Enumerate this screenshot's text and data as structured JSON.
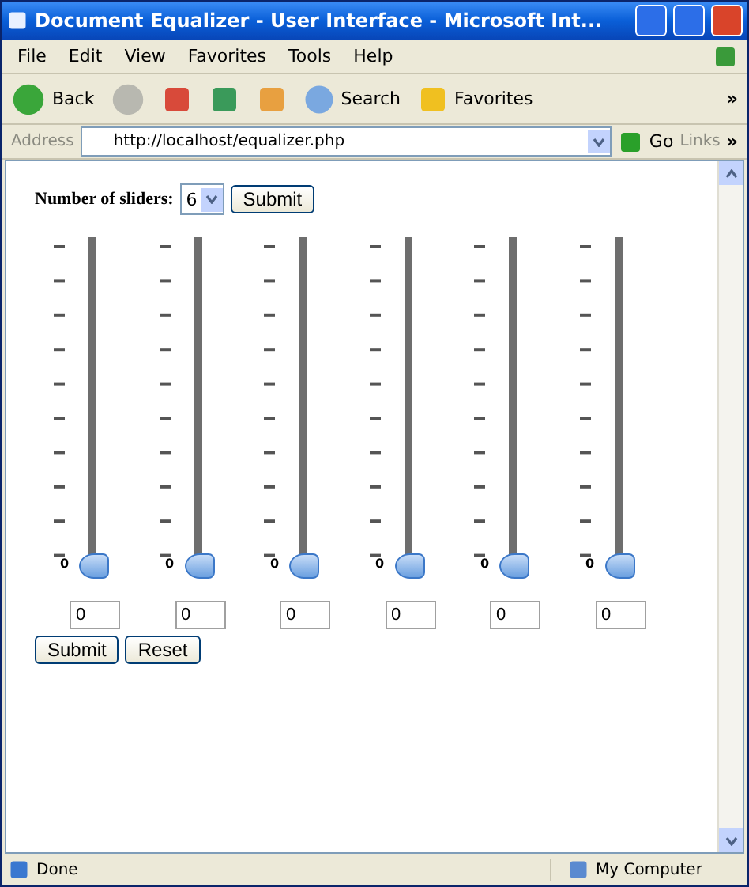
{
  "window": {
    "title": "Document Equalizer - User Interface - Microsoft Int..."
  },
  "menu": [
    "File",
    "Edit",
    "View",
    "Favorites",
    "Tools",
    "Help"
  ],
  "toolbar": {
    "back": "Back",
    "search": "Search",
    "favorites": "Favorites",
    "more": "»"
  },
  "address_bar": {
    "label": "Address",
    "url": "http://localhost/equalizer.php",
    "go": "Go",
    "links": "Links",
    "more": "»"
  },
  "form": {
    "sliders_label": "Number of sliders:",
    "sliders_count": "6",
    "submit": "Submit"
  },
  "sliders": [
    {
      "level": 0,
      "thumb_label": "0",
      "value": "0"
    },
    {
      "level": 0,
      "thumb_label": "0",
      "value": "0"
    },
    {
      "level": 0,
      "thumb_label": "0",
      "value": "0"
    },
    {
      "level": 0,
      "thumb_label": "0",
      "value": "0"
    },
    {
      "level": 0,
      "thumb_label": "0",
      "value": "0"
    },
    {
      "level": 0,
      "thumb_label": "0",
      "value": "0"
    }
  ],
  "buttons": [
    "Submit",
    "Reset"
  ],
  "status_bar": {
    "status": "Done",
    "zone": "My Computer"
  }
}
